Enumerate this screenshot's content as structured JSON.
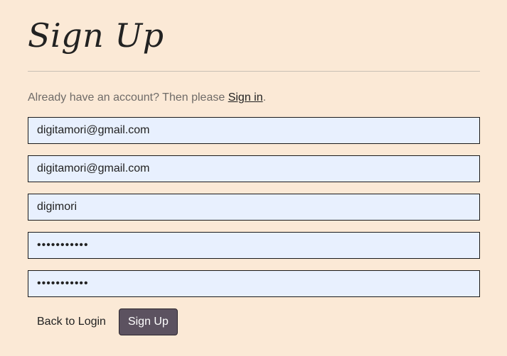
{
  "page": {
    "title": "Sign Up"
  },
  "signin_prompt": {
    "text": "Already have an account? Then please ",
    "link_label": "Sign in",
    "suffix": "."
  },
  "form": {
    "email": {
      "value": "digitamori@gmail.com"
    },
    "email_confirm": {
      "value": "digitamori@gmail.com"
    },
    "username": {
      "value": "digimori"
    },
    "password": {
      "value": "•••••••••••"
    },
    "password_confirm": {
      "value": "•••••••••••"
    }
  },
  "actions": {
    "back_label": "Back to Login",
    "signup_label": "Sign Up"
  },
  "colors": {
    "background": "#fbe9d6",
    "input_background": "#e8f0fe",
    "button_background": "#5c5260"
  }
}
